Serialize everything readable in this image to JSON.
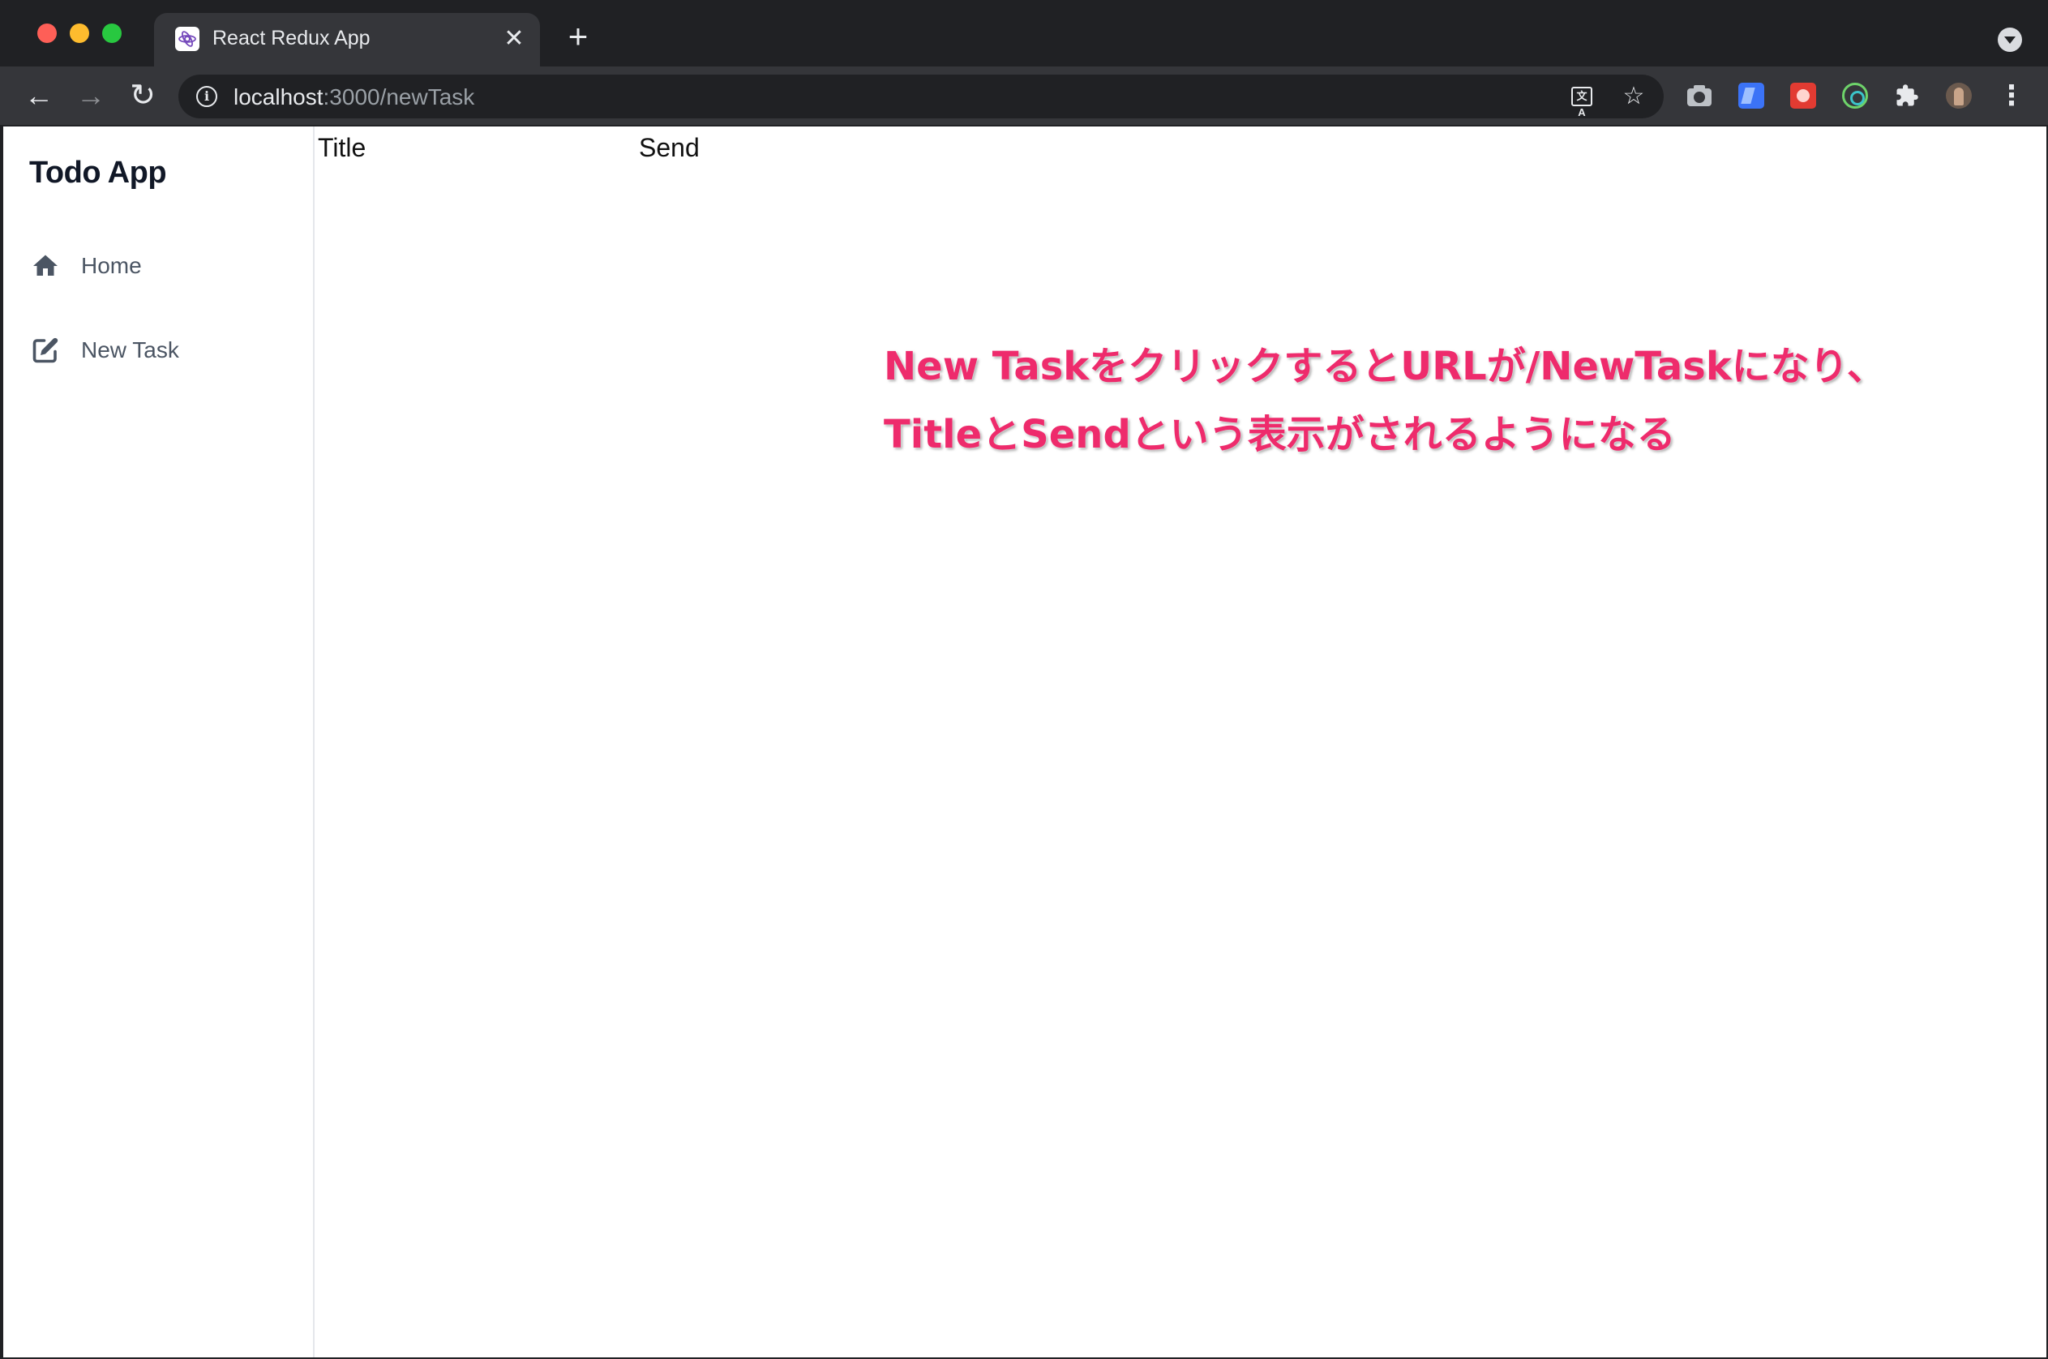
{
  "browser": {
    "tab": {
      "title": "React Redux App",
      "close_glyph": "✕"
    },
    "new_tab_glyph": "+",
    "omnibox": {
      "url_host": "localhost",
      "url_path": ":3000/newTask"
    },
    "icons": {
      "back": "←",
      "forward": "→",
      "reload": "↻",
      "star": "☆",
      "translate": "文A",
      "puzzle": "⧉",
      "kebab": "⋮"
    }
  },
  "app": {
    "title": "Todo App",
    "nav": [
      {
        "label": "Home",
        "icon": "home-icon"
      },
      {
        "label": "New Task",
        "icon": "edit-icon"
      }
    ]
  },
  "main": {
    "title_label": "Title",
    "send_label": "Send"
  },
  "annotation": {
    "line1": "New TaskをクリックするとURLが/NewTaskになり、",
    "line2": "TitleとSendという表示がされるようになる",
    "color": "#ee2b6c"
  }
}
